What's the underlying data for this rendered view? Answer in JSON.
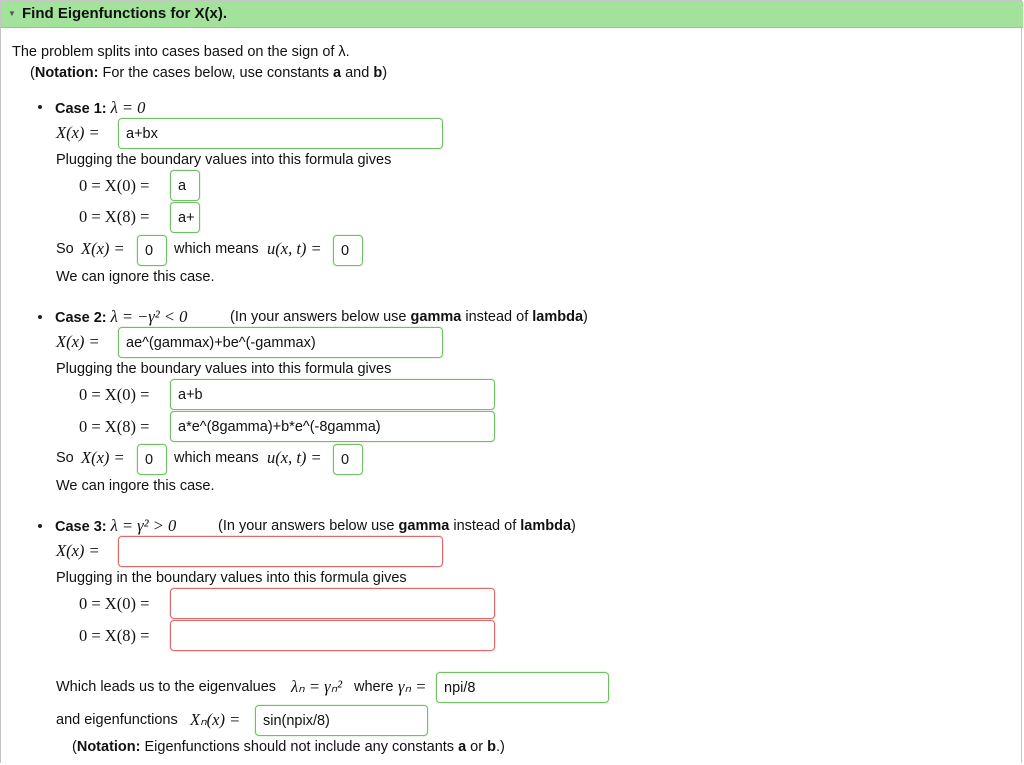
{
  "header": {
    "title": "Find Eigenfunctions for X(x)."
  },
  "intro": {
    "line1": "The problem splits into cases based on the sign of λ.",
    "notation_label": "Notation:",
    "notation_text": " For the cases below, use constants ",
    "const_a": "a",
    "and": " and ",
    "const_b": "b",
    "close": ")"
  },
  "case1": {
    "label": "Case 1:",
    "condition": "λ = 0",
    "x_label": "X(x) =",
    "x_value": "a+bx",
    "plugging": "Plugging the boundary values into this formula gives",
    "bc0_label": "0 = X(0) =",
    "bc0_value": "a",
    "bc8_label": "0 = X(8) =",
    "bc8_value": "a+",
    "so": "So",
    "so_x": "X(x) =",
    "so_x_value": "0",
    "which_means": "which means",
    "u_label": "u(x, t) =",
    "u_value": "0",
    "conclusion": "We can ignore this case."
  },
  "case2": {
    "label": "Case 2:",
    "condition": "λ = −γ² < 0",
    "hint_pre": "(In your answers below use ",
    "hint_gamma": "gamma",
    "hint_mid": " instead of ",
    "hint_lambda": "lambda",
    "hint_post": ")",
    "x_label": "X(x) =",
    "x_value": "ae^(gammax)+be^(-gammax)",
    "plugging": "Plugging the boundary values into this formula gives",
    "bc0_label": "0 = X(0) =",
    "bc0_value": "a+b",
    "bc8_label": "0 = X(8) =",
    "bc8_value": "a*e^(8gamma)+b*e^(-8gamma)",
    "so": "So",
    "so_x": "X(x) =",
    "so_x_value": "0",
    "which_means": "which means",
    "u_label": "u(x, t) =",
    "u_value": "0",
    "conclusion": "We can ingore this case."
  },
  "case3": {
    "label": "Case 3:",
    "condition": "λ = γ² > 0",
    "hint_pre": "(In your answers below use ",
    "hint_gamma": "gamma",
    "hint_mid": " instead of ",
    "hint_lambda": "lambda",
    "hint_post": ")",
    "x_label": "X(x) =",
    "x_value": "",
    "plugging": "Plugging in the boundary values into this formula gives",
    "bc0_label": "0 = X(0) =",
    "bc0_value": "",
    "bc8_label": "0 = X(8) =",
    "bc8_value": "",
    "eigen_text": "Which leads us to the eigenvalues",
    "eigen_math": "λₙ = γₙ²",
    "where": "where",
    "gamma_n": "γₙ =",
    "gamma_n_value": "npi/8",
    "eigenfn_text": "and eigenfunctions",
    "eigenfn_math": "Xₙ(x) =",
    "eigenfn_value": "sin(npix/8)",
    "note_open": "(",
    "note_label": "Notation:",
    "note_text": " Eigenfunctions should not include any constants ",
    "note_a": "a",
    "note_or": " or ",
    "note_b": "b",
    "note_close": ".)"
  },
  "colors": {
    "header_bg": "#a3e29a",
    "field_ok_border": "#6fbf63",
    "field_err_border": "#dc6a6a"
  }
}
